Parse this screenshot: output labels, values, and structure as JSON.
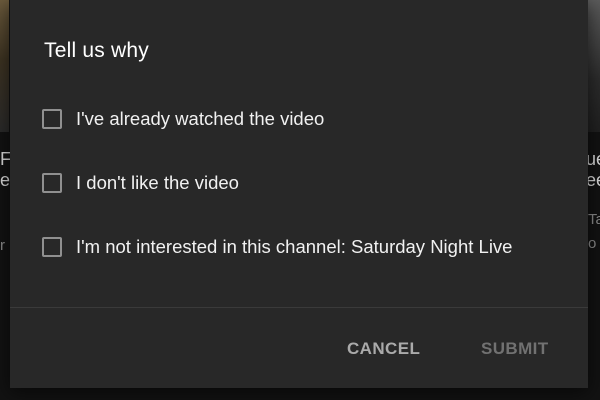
{
  "background": {
    "left_snippets": [
      "Fr",
      "ee",
      "r"
    ],
    "right_snippets": [
      "ue",
      "ee",
      "Ta",
      "o"
    ]
  },
  "dialog": {
    "title": "Tell us why",
    "options": [
      {
        "label": "I've already watched the video",
        "checked": false
      },
      {
        "label": "I don't like the video",
        "checked": false
      },
      {
        "label": "I'm not interested in this channel: Saturday Night Live",
        "checked": false
      }
    ],
    "cancel_label": "CANCEL",
    "submit_label": "SUBMIT"
  },
  "colors": {
    "dialog_bg": "#282828",
    "text_primary": "#ffffff",
    "checkbox_border": "#909090",
    "cancel_text": "#aaaaaa",
    "submit_disabled_text": "#717171"
  }
}
